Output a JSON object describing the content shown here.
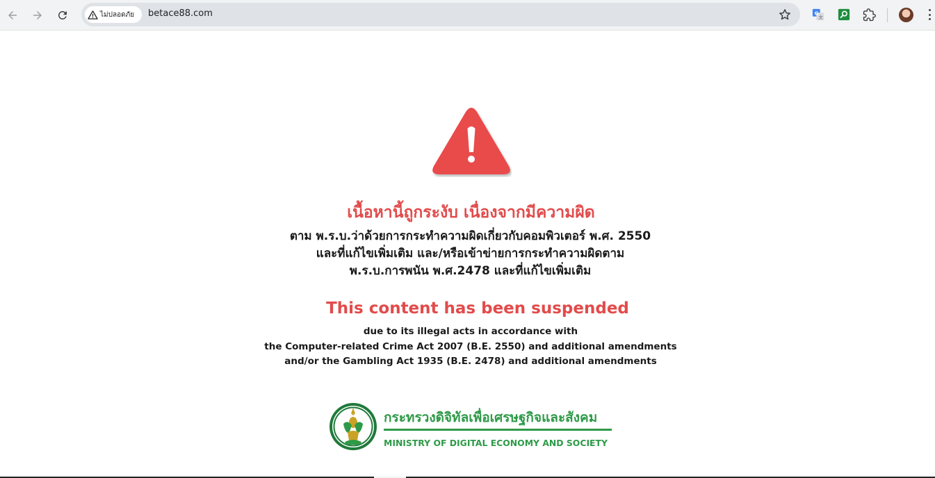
{
  "browser": {
    "security_label": "ไม่ปลอดภัย",
    "url": "betace88.com",
    "icons": [
      "back-arrow-icon",
      "forward-arrow-icon",
      "reload-icon",
      "warning-triangle-icon",
      "star-icon",
      "google-translate-icon",
      "search-extension-icon",
      "puzzle-icon",
      "avatar",
      "more-vert-icon"
    ]
  },
  "notice": {
    "thai_title": "เนื้อหานี้ถูกระงับ เนื่องจากมีความผิด",
    "thai_lines": [
      "ตาม พ.ร.บ.ว่าด้วยการกระทำความผิดเกี่ยวกับคอมพิวเตอร์ พ.ศ. 2550",
      "และที่แก้ไขเพิ่มเติม และ/หรือเข้าข่ายการกระทำความผิดตาม",
      "พ.ร.บ.การพนัน พ.ศ.2478 และที่แก้ไขเพิ่มเติม"
    ],
    "english_title": "This content has been suspended",
    "english_lines": [
      "due to its illegal acts in accordance with",
      "the Computer-related Crime Act 2007 (B.E. 2550) and additional amendments",
      "and/or the Gambling Act 1935 (B.E. 2478) and additional amendments"
    ],
    "accent_color": "#e24b4b"
  },
  "ministry": {
    "name_th": "กระทรวงดิจิทัลเพื่อเศรษฐกิจและสังคม",
    "name_en": "MINISTRY OF DIGITAL ECONOMY AND SOCIETY",
    "color": "#2e9a48"
  }
}
